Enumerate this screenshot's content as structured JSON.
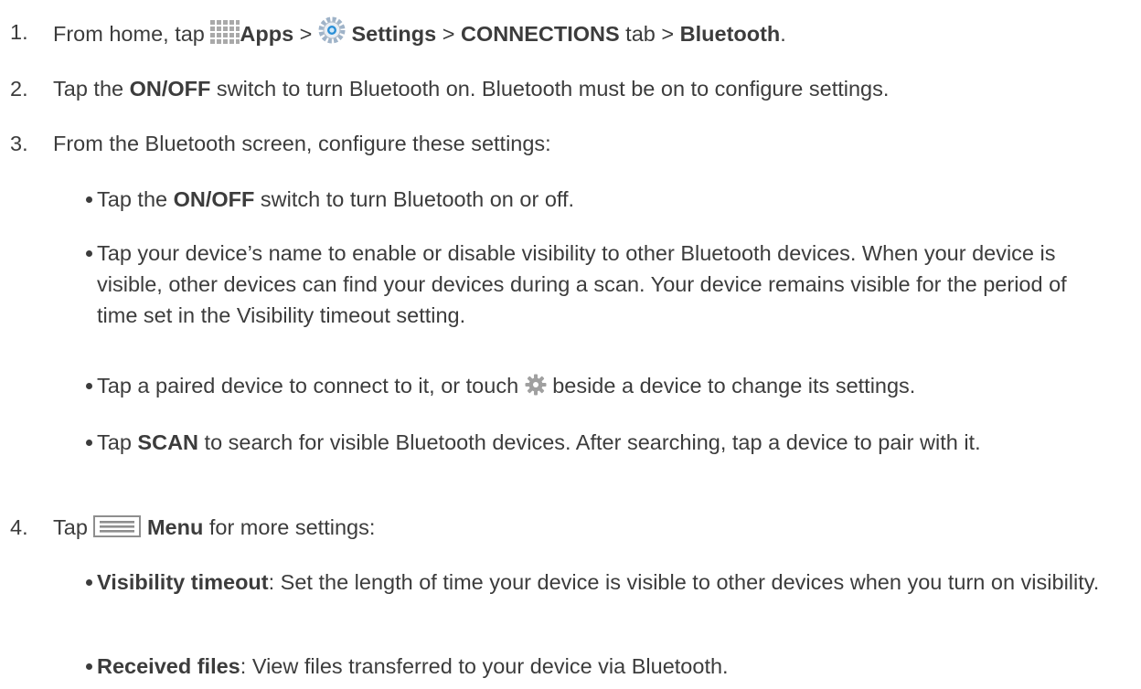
{
  "steps": [
    {
      "number": "1.",
      "from_home": "From home, tap ",
      "apps_icon": "apps-grid-icon",
      "apps": "Apps",
      "gt1": " > ",
      "settings_icon": "settings-gear-blue-icon",
      "settings": "Settings",
      "gt2": " > ",
      "connections": "CONNECTIONS",
      "tab": " tab > ",
      "bluetooth": "Bluetooth",
      "end": "."
    },
    {
      "number": "2.",
      "pre": "Tap the ",
      "onoff": "ON/OFF",
      "post": " switch to turn Bluetooth on. Bluetooth must be on to configure settings."
    },
    {
      "number": "3.",
      "text": "From the Bluetooth screen, configure these settings:",
      "bullets": [
        {
          "pre": "Tap the ",
          "bold": "ON/OFF",
          "post": " switch to turn Bluetooth on or off."
        },
        {
          "text": "Tap your device’s name to enable or disable visibility to other Bluetooth devices. When your device is visible, other devices can find your devices during a scan. Your device remains visible for the period of time set in the Visibility timeout setting."
        },
        {
          "pre": "Tap a paired device to connect to it, or touch ",
          "icon": "gear-icon",
          "post": " beside a device to change its settings."
        },
        {
          "pre": "Tap ",
          "bold": "SCAN",
          "post": " to search for visible Bluetooth devices. After searching, tap a device to pair with it."
        }
      ]
    },
    {
      "number": "4.",
      "pre": "Tap ",
      "menu_icon": "menu-icon",
      "menu": "Menu",
      "post": " for more settings:",
      "bullets": [
        {
          "bold": "Visibility timeout",
          "post": ": Set the length of time your device is visible to other devices when you turn on visibility."
        },
        {
          "bold": "Received files",
          "post": ": View files transferred to your device via Bluetooth."
        }
      ]
    }
  ]
}
